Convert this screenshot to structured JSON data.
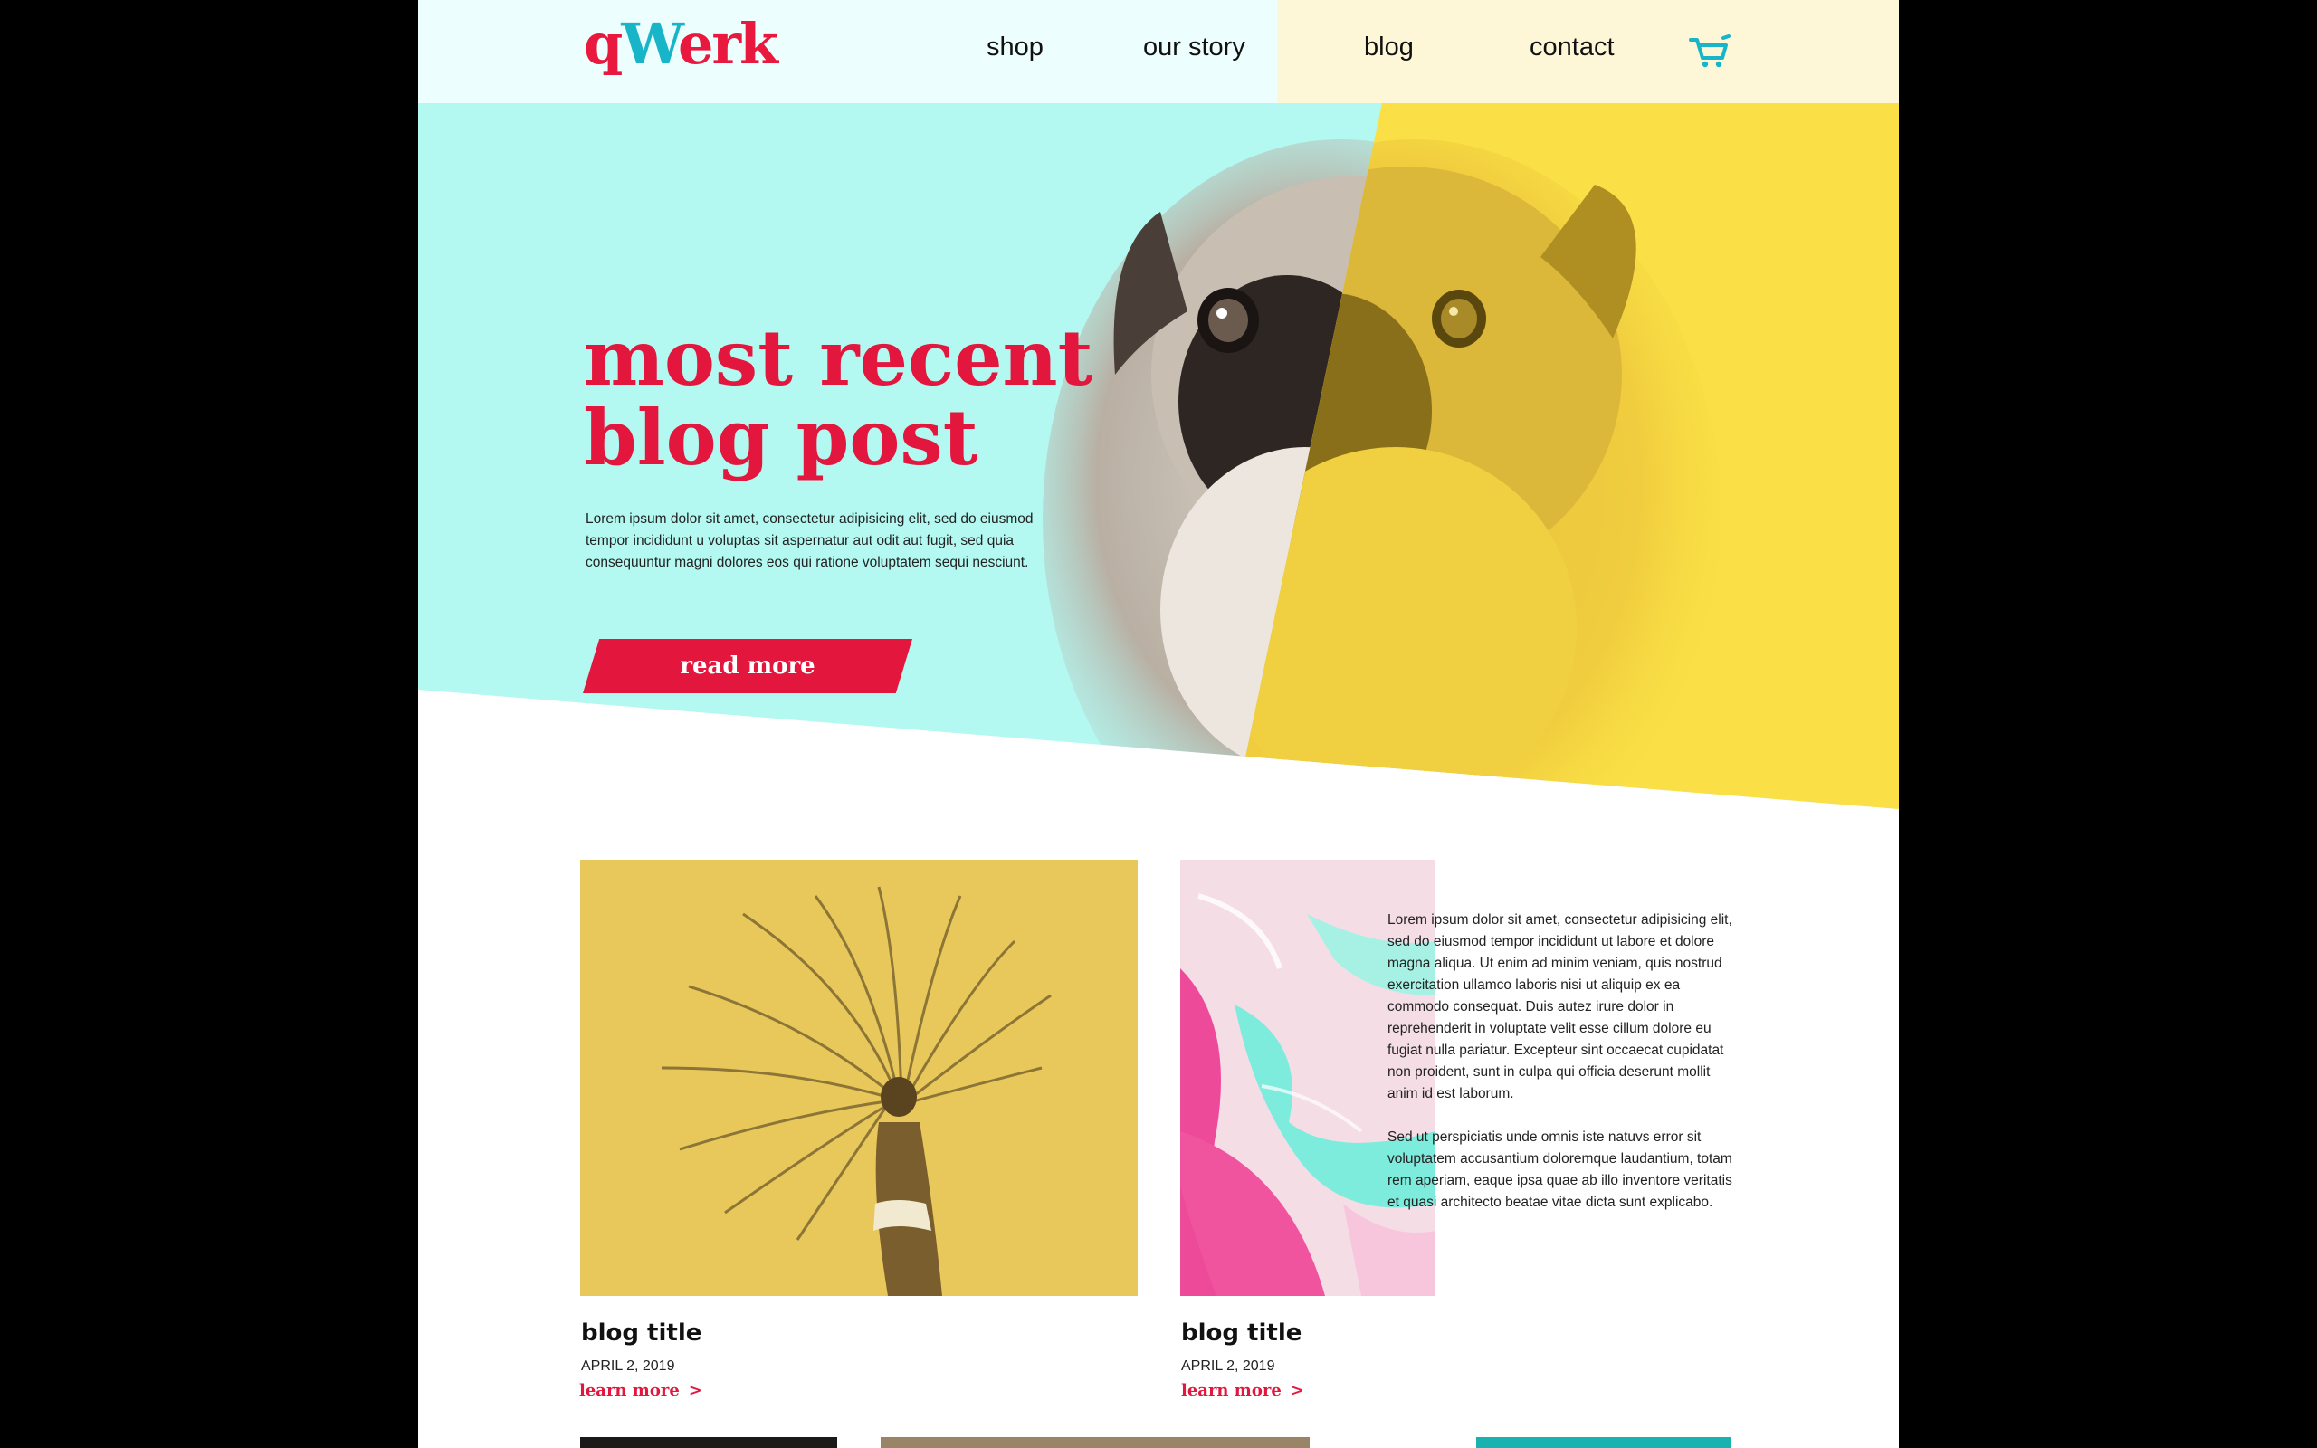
{
  "brand": {
    "logo_parts": [
      "q",
      "W",
      "erk"
    ],
    "colors": {
      "pink": "#e3163d",
      "teal": "#18b5c9",
      "aqua": "#b3f8f1",
      "yellow": "#fae046"
    }
  },
  "nav": {
    "items": [
      {
        "label": "shop"
      },
      {
        "label": "our story"
      },
      {
        "label": "blog"
      },
      {
        "label": "contact"
      }
    ],
    "cart_icon": "shopping-cart-icon"
  },
  "hero": {
    "title_line1": "most recent",
    "title_line2": "blog post",
    "text": "Lorem ipsum dolor sit amet, consectetur adipisicing elit, sed do eiusmod tempor incididunt u voluptas sit aspernatur aut odit aut fugit, sed quia consequuntur magni dolores eos qui ratione voluptatem sequi nesciunt.",
    "button_label": "read more",
    "image": "pug-photo"
  },
  "cards": [
    {
      "title": "blog title",
      "date": "APRIL 2, 2019",
      "link": "learn more",
      "image": "dancer-braids-photo"
    },
    {
      "title": "blog title",
      "date": "APRIL 2, 2019",
      "link": "learn more",
      "image": "pink-teal-marble-photo",
      "paragraph1": "Lorem ipsum dolor sit amet, consectetur adipisicing elit, sed do eiusmod tempor incididunt ut labore et dolore magna aliqua. Ut enim ad minim veniam, quis nostrud exercitation ullamco laboris nisi ut aliquip ex ea commodo consequat. Duis autez irure dolor in reprehenderit in voluptate velit esse cillum dolore eu fugiat nulla pariatur. Excepteur sint occaecat cupidatat non proident, sunt in culpa qui officia deserunt mollit anim id est laborum.",
      "paragraph2": "Sed ut perspiciatis unde omnis iste natuvs error sit voluptatem accusantium doloremque laudantium, totam rem aperiam, eaque ipsa quae ab illo inventore veritatis et quasi architecto beatae vitae dicta sunt explicabo."
    }
  ]
}
